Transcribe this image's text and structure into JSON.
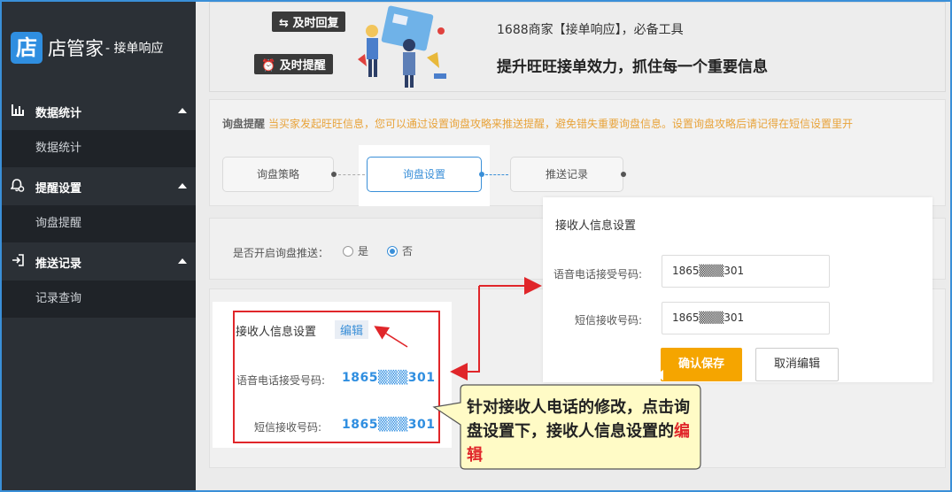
{
  "sidebar": {
    "logo_char": "店",
    "logo_text": "店管家",
    "logo_sub": "- 接单响应",
    "groups": [
      {
        "label": "数据统计",
        "sub": "数据统计"
      },
      {
        "label": "提醒设置",
        "sub": "询盘提醒"
      },
      {
        "label": "推送记录",
        "sub": "记录查询"
      }
    ]
  },
  "banner": {
    "chip_reply": "及时回复",
    "chip_remind": "及时提醒",
    "title": "1688商家【接单响应】，必备工具",
    "slogan": "提升旺旺接单效力，抓住每一个重要信息"
  },
  "notice": {
    "label": "询盘提醒",
    "text": "当买家发起旺旺信息，您可以通过设置询盘攻略来推送提醒，避免错失重要询盘信息。设置询盘攻略后请记得在短信设置里开"
  },
  "steps": [
    "询盘策略",
    "询盘设置",
    "推送记录"
  ],
  "push": {
    "label": "是否开启询盘推送：",
    "yes": "是",
    "no": "否",
    "selected": "否"
  },
  "receiver": {
    "title": "接收人信息设置",
    "edit": "编辑",
    "voice_label": "语音电话接受号码:",
    "voice_value": "1865▒▒▒301",
    "sms_label": "短信接收号码:",
    "sms_value": "1865▒▒▒301"
  },
  "popup": {
    "title": "接收人信息设置",
    "voice_label": "语音电话接受号码:",
    "voice_value": "1865▒▒▒301",
    "sms_label": "短信接收号码:",
    "sms_value": "1865▒▒▒301",
    "save": "确认保存",
    "cancel": "取消编辑"
  },
  "callout": {
    "text": "针对接收人电话的修改，点击询盘设置下，接收人信息设置的",
    "highlight": "编辑"
  },
  "colors": {
    "sidebar": "#2b3036",
    "accent": "#3a8fd8",
    "annotation": "#e0262a",
    "save_button": "#f5a500",
    "callout": "#fffbc6"
  }
}
